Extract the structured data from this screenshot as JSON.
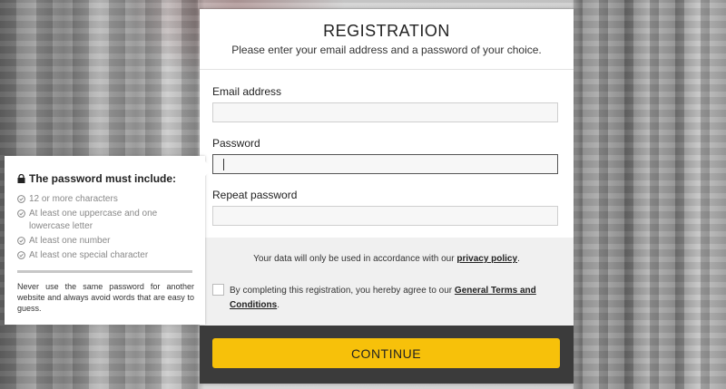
{
  "header": {
    "title": "REGISTRATION",
    "subtitle": "Please enter your email address and a password of your choice."
  },
  "form": {
    "email_label": "Email address",
    "email_value": "",
    "password_label": "Password",
    "password_value": "",
    "repeat_label": "Repeat password",
    "repeat_value": ""
  },
  "consent": {
    "privacy_prefix": "Your data will only be used in accordance with our ",
    "privacy_link": "privacy policy",
    "privacy_suffix": ".",
    "terms_prefix": "By completing this registration, you hereby agree to our ",
    "terms_link": "General Terms and Conditions",
    "terms_suffix": ".",
    "terms_checked": false
  },
  "footer": {
    "continue_label": "CONTINUE"
  },
  "tooltip": {
    "heading": "The password must include:",
    "rules": [
      "12 or more characters",
      "At least one uppercase and one lowercase letter",
      "At least one number",
      "At least one special character"
    ],
    "strength_fraction": 0,
    "note": "Never use the same password for another website and always avoid words that are easy to guess."
  },
  "icons": {
    "heading": "lock-icon",
    "rule": "check-circle-icon"
  },
  "colors": {
    "accent": "#f7c10a",
    "footer": "#3b3b3b",
    "rule_text": "#888888"
  }
}
